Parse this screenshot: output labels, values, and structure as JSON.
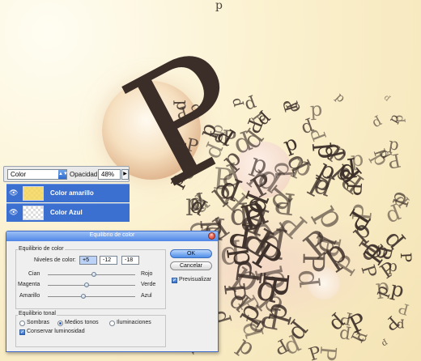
{
  "canvas": {
    "background": "#fbf1cf",
    "glyph": "p",
    "big_glyph": "P"
  },
  "layers_panel": {
    "blend_mode": "Color",
    "opacity_label": "Opacidad:",
    "opacity_value": "48%",
    "layers": [
      {
        "name": "Color amarillo",
        "visible": true,
        "thumb_color": "#f4d65a"
      },
      {
        "name": "Color Azul",
        "visible": true,
        "thumb_color": "transparent"
      }
    ]
  },
  "dialog": {
    "title": "Equilibrio de color",
    "balance_group": "Equilibrio de color",
    "levels_label": "Niveles de color:",
    "levels": [
      "+5",
      "-12",
      "-18"
    ],
    "sliders": [
      {
        "left": "Cian",
        "right": "Rojo",
        "value": 5
      },
      {
        "left": "Magenta",
        "right": "Verde",
        "value": -12
      },
      {
        "left": "Amarillo",
        "right": "Azul",
        "value": -18
      }
    ],
    "tonal_group": "Equilibrio tonal",
    "tones": [
      "Sombras",
      "Medios tonos",
      "Iluminaciones"
    ],
    "selected_tone": "Medios tonos",
    "preserve_luminosity": "Conservar luminosidad",
    "ok": "OK",
    "cancel": "Cancelar",
    "preview": "Previsualizar",
    "accent": "#4f86e6"
  }
}
